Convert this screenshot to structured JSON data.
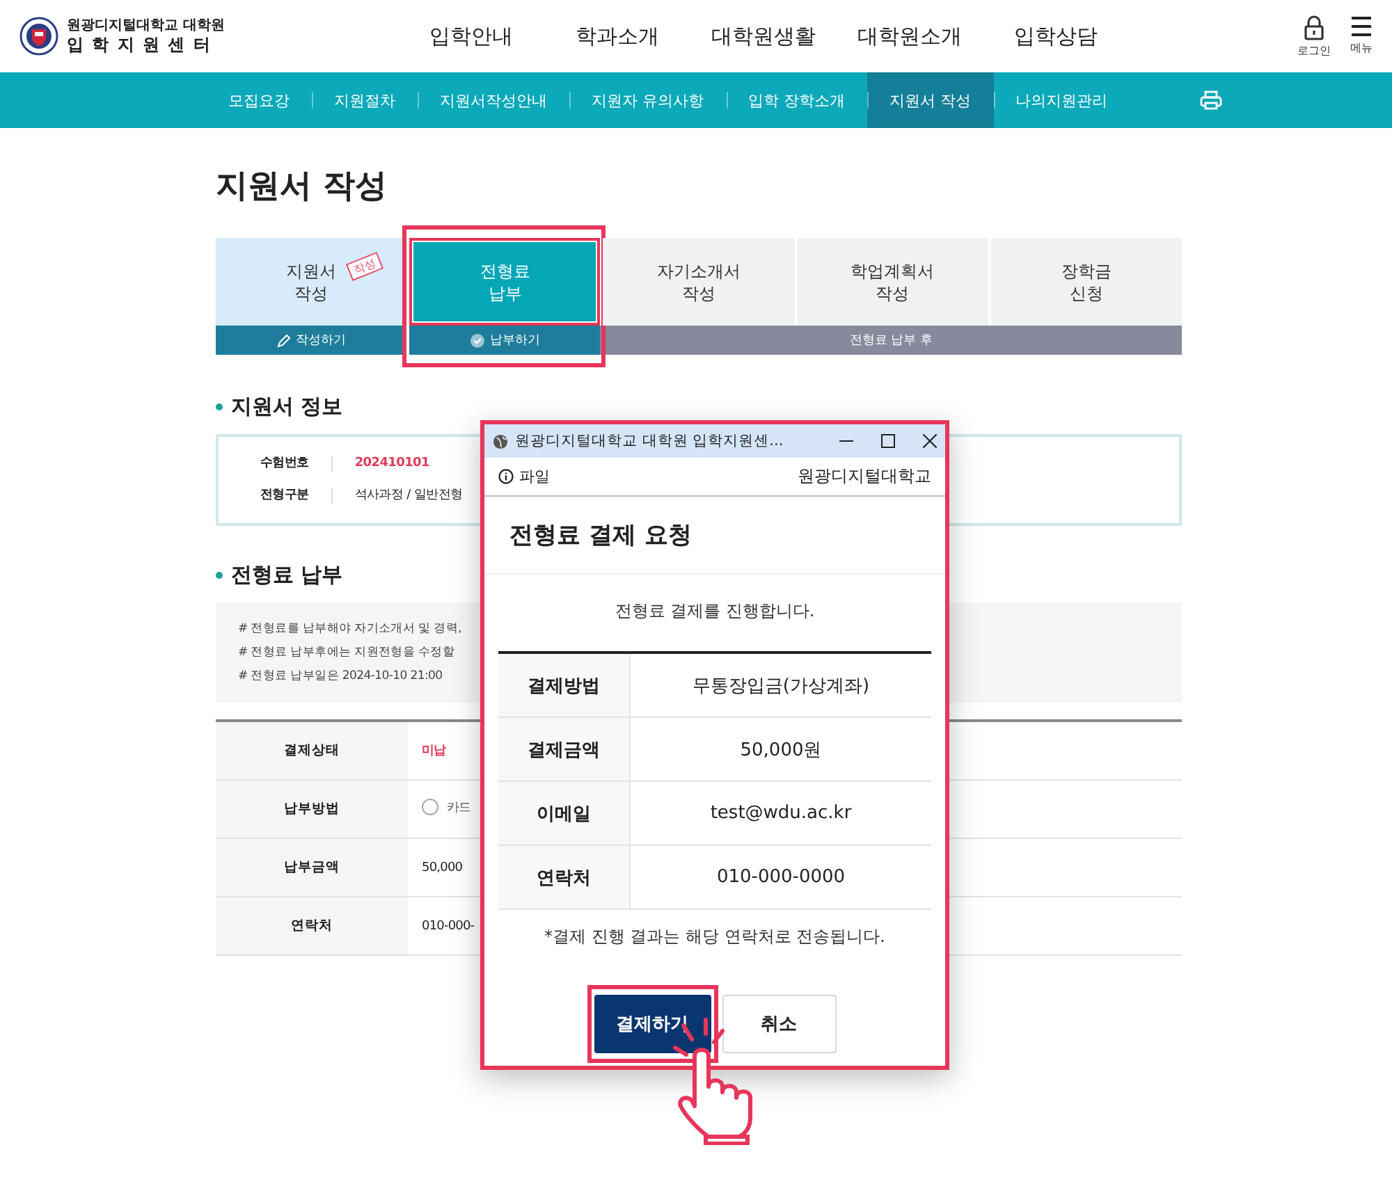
{
  "header": {
    "logo_top": "원광디지털대학교 대학원",
    "logo_bottom": "입 학 지 원 센 터",
    "menu": [
      "입학안내",
      "학과소개",
      "대학원생활",
      "대학원소개",
      "입학상담"
    ],
    "login": "로그인",
    "menu_label": "메뉴"
  },
  "subnav": [
    {
      "label": "모집요강",
      "selected": false
    },
    {
      "label": "지원절차",
      "selected": false
    },
    {
      "label": "지원서작성안내",
      "selected": false
    },
    {
      "label": "지원자 유의사항",
      "selected": false
    },
    {
      "label": "입학 장학소개",
      "selected": false
    },
    {
      "label": "지원서 작성",
      "selected": true
    },
    {
      "label": "나의지원관리",
      "selected": false
    }
  ],
  "page_title": "지원서 작성",
  "steps": [
    {
      "label": "지원서\n작성",
      "kind": "done",
      "action": "작성하기",
      "stamp": "작성",
      "selected": false,
      "highlighted": false
    },
    {
      "label": "전형료\n납부",
      "kind": "current",
      "action": "납부하기",
      "selected": true,
      "highlighted": true
    },
    {
      "label": "자기소개서\n작성",
      "kind": "locked",
      "selected": false,
      "highlighted": false
    },
    {
      "label": "학업계획서\n작성",
      "kind": "locked",
      "selected": false,
      "highlighted": false
    },
    {
      "label": "장학금\n신청",
      "kind": "locked",
      "selected": false,
      "highlighted": false
    }
  ],
  "locked_note": "전형료 납부 후",
  "info_section": {
    "title": "지원서 정보",
    "rows": [
      {
        "label": "수험번호",
        "value": "202410101",
        "kind": "accent"
      },
      {
        "label": "전형구분",
        "value": "석사과정 / 일반전형",
        "kind": "plain"
      }
    ]
  },
  "payment_section": {
    "title": "전형료 납부",
    "notes": [
      "# 전형료를 납부해야 자기소개서 및 경력,",
      "# 전형료 납부후에는 지원전형을 수정할",
      "# 전형료 납부일은 2024-10-10 21:00"
    ],
    "rows": [
      {
        "label": "결제상태",
        "value": "미납",
        "kind": "accent"
      },
      {
        "label": "납부방법",
        "value": "카드",
        "kind": "radio",
        "checked": false
      },
      {
        "label": "납부금액",
        "value": "50,000",
        "kind": "plain"
      },
      {
        "label": "연락처",
        "value": "010-000-",
        "kind": "plain"
      }
    ]
  },
  "popup": {
    "window_title": "원광디지털대학교 대학원 입학지원센...",
    "address_label": "파일",
    "site_name": "원광디지털대학교",
    "title": "전형료 결제 요청",
    "intro": "전형료 결제를 진행합니다.",
    "rows": [
      {
        "label": "결제방법",
        "value": "무통장입금(가상계좌)"
      },
      {
        "label": "결제금액",
        "value": "50,000원"
      },
      {
        "label": "이메일",
        "value": "test@wdu.ac.kr"
      },
      {
        "label": "연락처",
        "value": "010-000-0000"
      }
    ],
    "note": "*결제 진행 결과는 해당 연락처로 전송됩니다.",
    "buttons": [
      {
        "label": "결제하기",
        "kind": "primary",
        "highlighted": true
      },
      {
        "label": "취소",
        "kind": "secondary",
        "highlighted": false
      }
    ]
  }
}
